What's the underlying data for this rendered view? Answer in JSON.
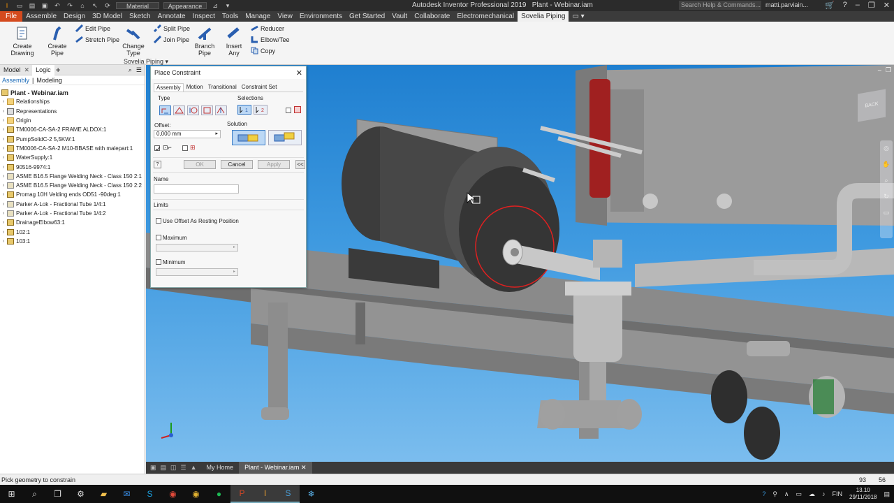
{
  "window": {
    "app_title": "Autodesk Inventor Professional 2019",
    "doc_title": "Plant - Webinar.iam",
    "search_placeholder": "Search Help & Commands...",
    "user": "matti.parviain...",
    "material_dropdown": "Material",
    "appearance_dropdown": "Appearance"
  },
  "menu": {
    "tabs": [
      "File",
      "Assemble",
      "Design",
      "3D Model",
      "Sketch",
      "Annotate",
      "Inspect",
      "Tools",
      "Manage",
      "View",
      "Environments",
      "Get Started",
      "Vault",
      "Collaborate",
      "Electromechanical",
      "Sovelia Piping"
    ],
    "active": "Sovelia Piping"
  },
  "ribbon": {
    "create_drawing": "Create Drawing",
    "create_pipe": "Create Pipe",
    "edit_pipe": "Edit Pipe",
    "stretch_pipe": "Stretch Pipe",
    "change_type": "Change Type",
    "split_pipe": "Split Pipe",
    "join_pipe": "Join Pipe",
    "branch_pipe": "Branch Pipe",
    "insert_any": "Insert Any",
    "reducer": "Reducer",
    "elbow_tee": "Elbow/Tee",
    "copy": "Copy",
    "panel_label": "Sovelia Piping"
  },
  "browser": {
    "tab_model": "Model",
    "tab_logic": "Logic",
    "sub_assembly": "Assembly",
    "sub_modeling": "Modeling",
    "root": "Plant - Webinar.iam",
    "items": [
      {
        "label": "Relationships",
        "icon": "folder"
      },
      {
        "label": "Representations",
        "icon": "rep"
      },
      {
        "label": "Origin",
        "icon": "folder"
      },
      {
        "label": "TM0006-CA-SA-2 FRAME ALDOX:1",
        "icon": "asm"
      },
      {
        "label": "PumpSolidC-2 5,5KW:1",
        "icon": "asm"
      },
      {
        "label": "TM0006-CA-SA-2 M10-BBASE with malepart:1",
        "icon": "asm"
      },
      {
        "label": "WaterSupply:1",
        "icon": "asm"
      },
      {
        "label": "90516-9974:1",
        "icon": "asm"
      },
      {
        "label": "ASME B16.5 Flange Welding Neck - Class 150 2:1",
        "icon": "part"
      },
      {
        "label": "ASME B16.5 Flange Welding Neck - Class 150 2:2",
        "icon": "part"
      },
      {
        "label": "Promag 10H Velding ends OD51 -90deg:1",
        "icon": "asm"
      },
      {
        "label": "Parker A-Lok - Fractional Tube 1/4:1",
        "icon": "part"
      },
      {
        "label": "Parker A-Lok - Fractional Tube 1/4:2",
        "icon": "part"
      },
      {
        "label": "DrainageElbow63:1",
        "icon": "asm"
      },
      {
        "label": "102:1",
        "icon": "asm"
      },
      {
        "label": "103:1",
        "icon": "asm"
      }
    ]
  },
  "dialog": {
    "title": "Place Constraint",
    "tabs": [
      "Assembly",
      "Motion",
      "Transitional",
      "Constraint Set"
    ],
    "type_label": "Type",
    "selections_label": "Selections",
    "offset_label": "Offset:",
    "offset_value": "0,000 mm",
    "solution_label": "Solution",
    "ok": "OK",
    "cancel": "Cancel",
    "apply": "Apply",
    "collapse": "<<",
    "name_label": "Name",
    "name_value": "",
    "limits_label": "Limits",
    "use_offset": "Use Offset As Resting Position",
    "maximum": "Maximum",
    "minimum": "Minimum"
  },
  "doctabs": {
    "home": "My Home",
    "active": "Plant - Webinar.iam"
  },
  "viewcube_label": "BACK",
  "status": {
    "text": "Pick geometry to constrain",
    "n1": "93",
    "n2": "56"
  },
  "taskbar": {
    "time": "13.10",
    "date": "29/11/2018",
    "lang": "FIN"
  }
}
